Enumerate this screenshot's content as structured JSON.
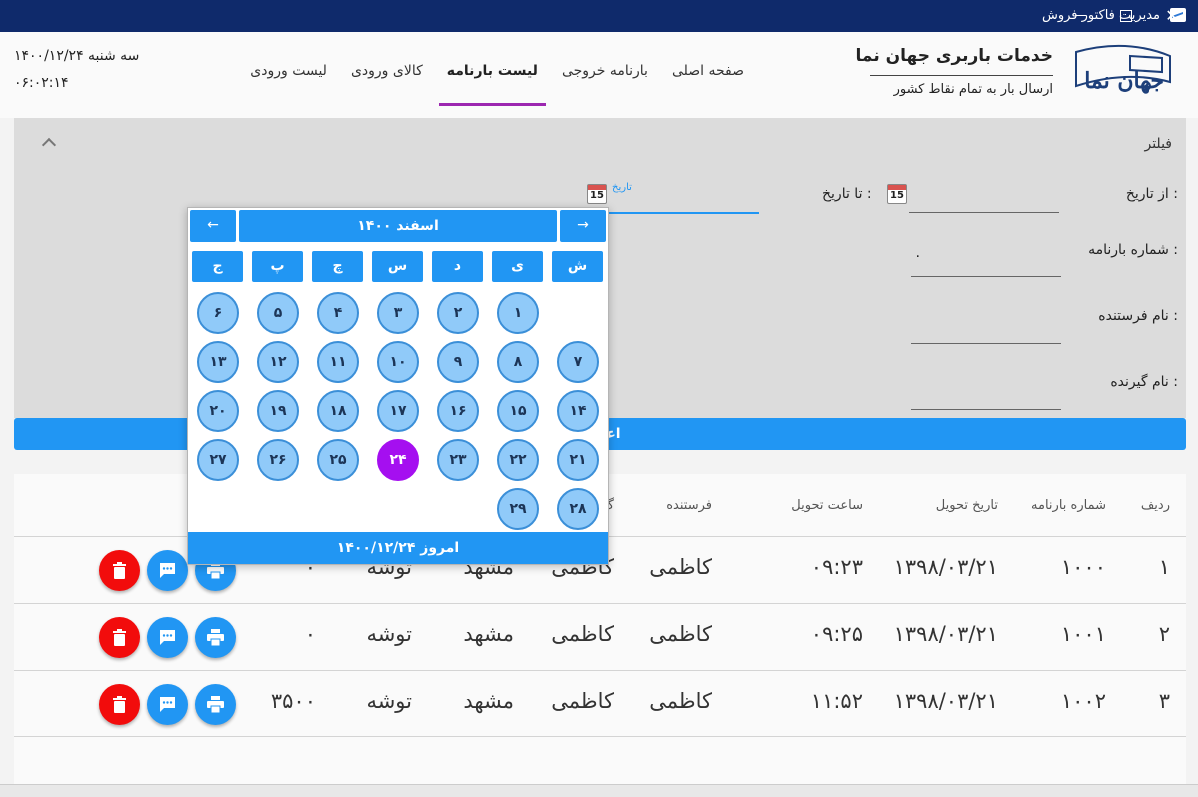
{
  "window": {
    "title": "مدیریت فاکتور فروش"
  },
  "header": {
    "logo_text": "جهان نما",
    "company_name": "خدمات باربری جهان نما",
    "company_sub": "ارسال بار به تمام نقاط کشور",
    "datetime_day": "سه شنبه ۱۴۰۰/۱۲/۲۴",
    "datetime_time": "۰۶:۰۲:۱۴",
    "nav": [
      {
        "label": "صفحه اصلی"
      },
      {
        "label": "بارنامه خروجی"
      },
      {
        "label": "لیست بارنامه"
      },
      {
        "label": "کالای ورودی"
      },
      {
        "label": "لیست ورودی"
      }
    ],
    "active_nav": "لیست بارنامه"
  },
  "filter": {
    "title": "فیلتر",
    "from_label": "از تاریخ :",
    "to_label": "تا تاریخ :",
    "date_hint": "تاریخ",
    "calendar_icon_text": "15",
    "waybill_label": "شماره بارنامه :",
    "waybill_value": "۰",
    "sender_label": "نام فرستنده :",
    "receiver_label": "نام گیرنده :"
  },
  "apply_button": "اعمال",
  "table": {
    "headers": [
      "ردیف",
      "شماره بارنامه",
      "تاریخ تحویل",
      "ساعت تحویل",
      "فرستنده",
      "گ"
    ],
    "rows": [
      {
        "index": "۱",
        "number": "۱۰۰۰",
        "date": "۱۳۹۸/۰۳/۲۱",
        "time": "۰۹:۲۳",
        "sender": "کاظمی",
        "receiver": "کاظمی",
        "city": "مشهد",
        "type": "توشه",
        "amount": "۰"
      },
      {
        "index": "۲",
        "number": "۱۰۰۱",
        "date": "۱۳۹۸/۰۳/۲۱",
        "time": "۰۹:۲۵",
        "sender": "کاظمی",
        "receiver": "کاظمی",
        "city": "مشهد",
        "type": "توشه",
        "amount": "۰"
      },
      {
        "index": "۳",
        "number": "۱۰۰۲",
        "date": "۱۳۹۸/۰۳/۲۱",
        "time": "۱۱:۵۲",
        "sender": "کاظمی",
        "receiver": "کاظمی",
        "city": "مشهد",
        "type": "توشه",
        "amount": "۳۵۰۰"
      }
    ]
  },
  "calendar": {
    "month_title": "اسفند ۱۴۰۰",
    "prev_arrow": "←",
    "next_arrow": "→",
    "weekdays": [
      "ش",
      "ی",
      "د",
      "س",
      "چ",
      "پ",
      "ج"
    ],
    "days": [
      "۱",
      "۲",
      "۳",
      "۴",
      "۵",
      "۶",
      "۷",
      "۸",
      "۹",
      "۱۰",
      "۱۱",
      "۱۲",
      "۱۳",
      "۱۴",
      "۱۵",
      "۱۶",
      "۱۷",
      "۱۸",
      "۱۹",
      "۲۰",
      "۲۱",
      "۲۲",
      "۲۳",
      "۲۴",
      "۲۵",
      "۲۶",
      "۲۷",
      "۲۸",
      "۲۹"
    ],
    "first_day_col": 1,
    "selected_day": 24,
    "today_text": "امروز ۱۴۰۰/۱۲/۲۴"
  },
  "colors": {
    "accent": "#2196f3",
    "selected": "#a50ff0",
    "delete": "#f20c0c",
    "titlebar": "#0f2a6b"
  }
}
